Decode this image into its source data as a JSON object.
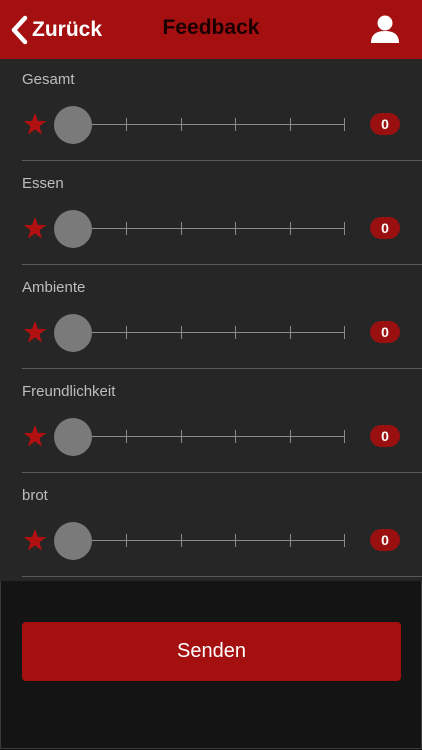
{
  "header": {
    "back_label": "Zurück",
    "title": "Feedback"
  },
  "ratings": [
    {
      "label": "Gesamt",
      "value": "0"
    },
    {
      "label": "Essen",
      "value": "0"
    },
    {
      "label": "Ambiente",
      "value": "0"
    },
    {
      "label": "Freundlichkeit",
      "value": "0"
    },
    {
      "label": "brot",
      "value": "0"
    }
  ],
  "slider_min": 0,
  "slider_max": 5,
  "send_label": "Senden",
  "icons": {
    "back": "chevron-left-icon",
    "user": "user-icon",
    "rating": "star-icon"
  },
  "colors": {
    "accent": "#a40f0f",
    "background": "#262626",
    "page": "#141414"
  }
}
